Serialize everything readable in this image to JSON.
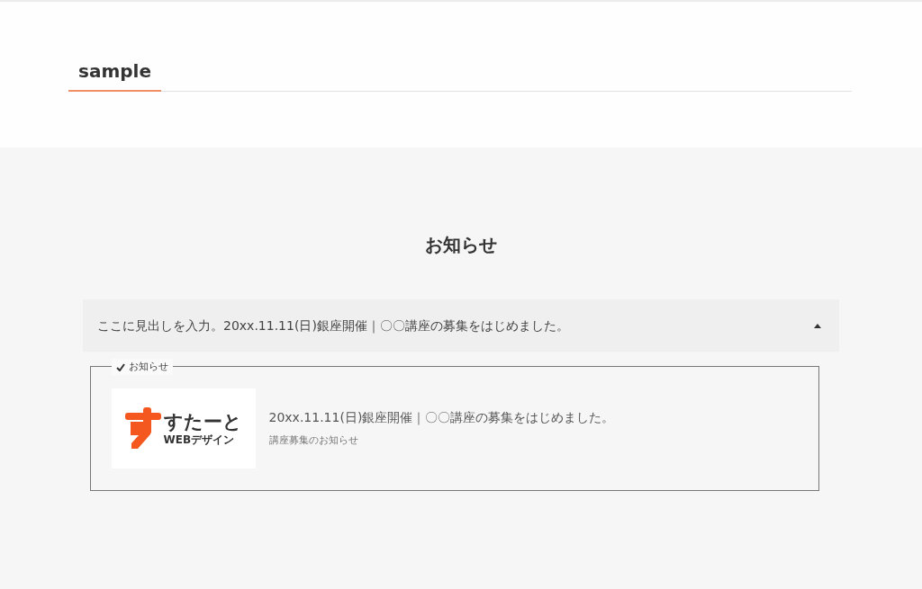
{
  "section_title": "sample",
  "news": {
    "heading": "お知らせ",
    "accordion": {
      "title": "ここに見出しを入力。20xx.11.11(日)銀座開催｜〇〇講座の募集をはじめました。",
      "expanded": true
    },
    "card": {
      "tag": "お知らせ",
      "logo": {
        "name": "すたーと",
        "subtitle": "WEBデザイン"
      },
      "title": "20xx.11.11(日)銀座開催｜〇〇講座の募集をはじめました。",
      "excerpt": "講座募集のお知らせ"
    }
  }
}
